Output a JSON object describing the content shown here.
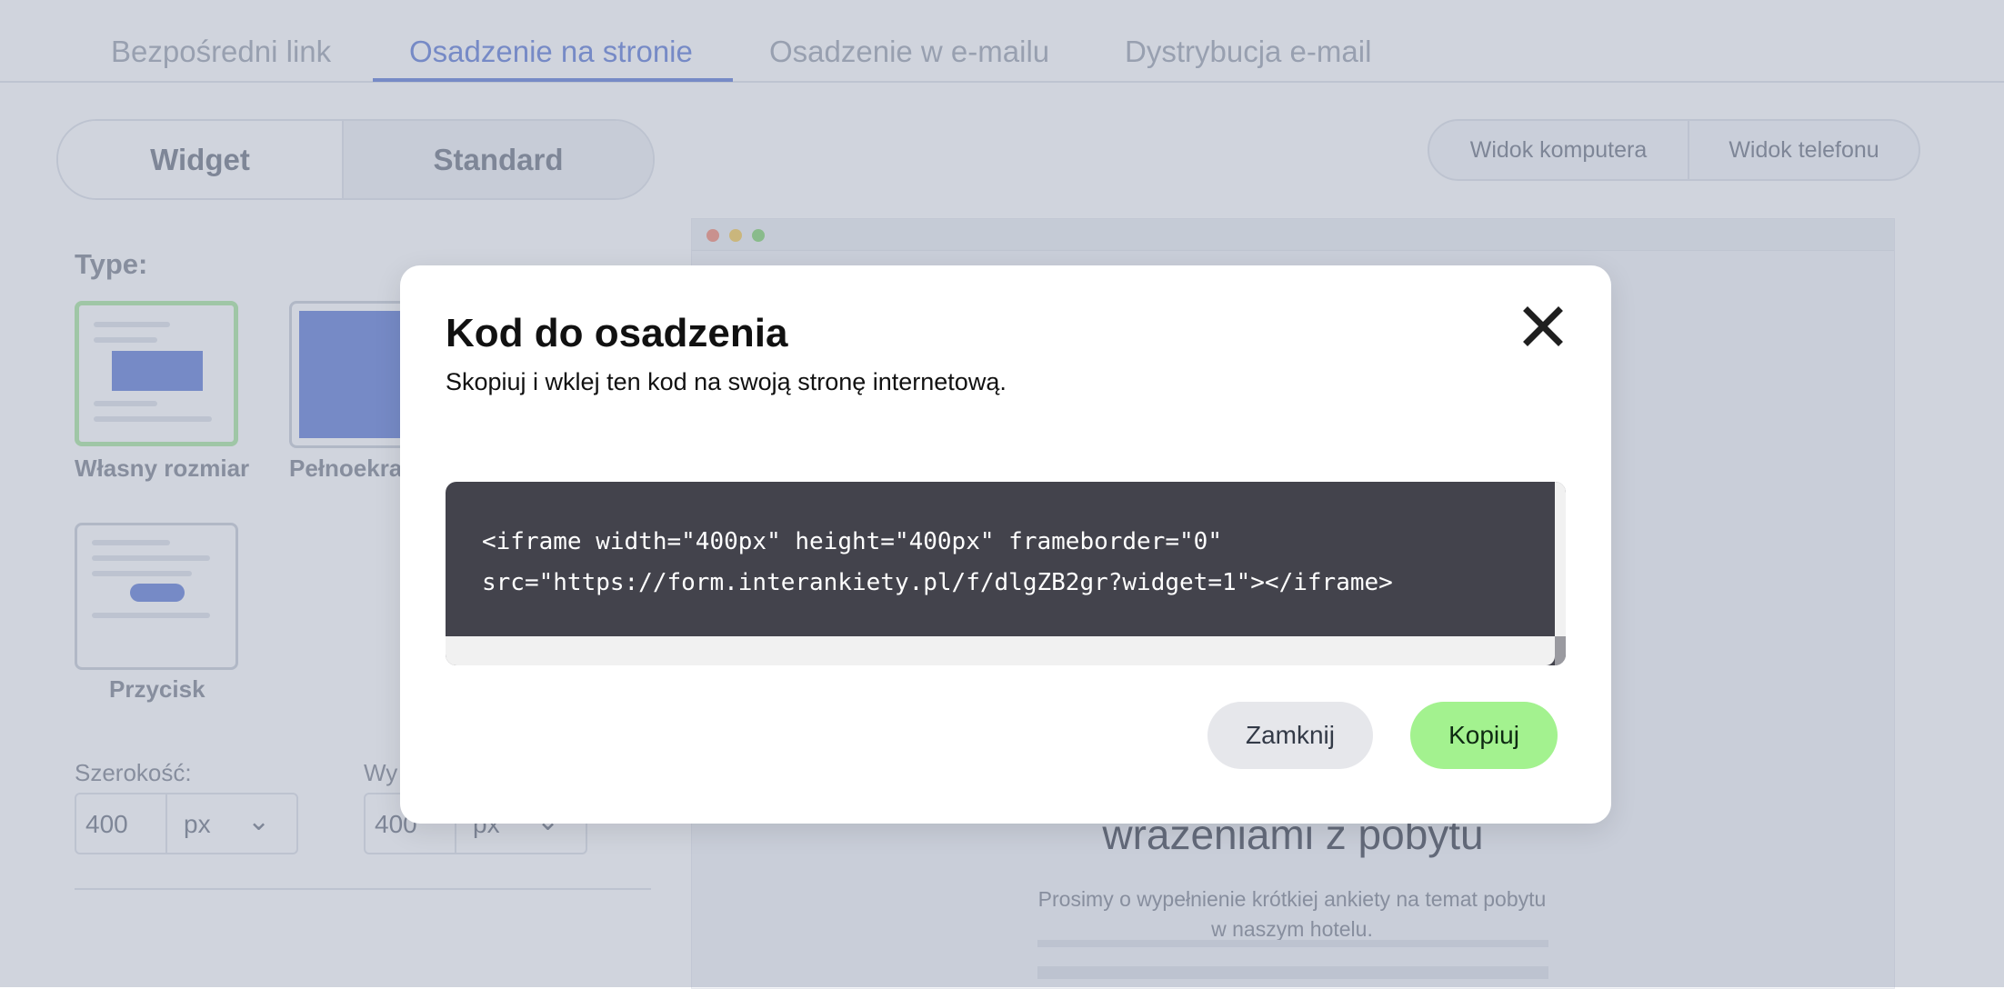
{
  "tabs": [
    {
      "label": "Bezpośredni link",
      "active": false
    },
    {
      "label": "Osadzenie na stronie",
      "active": true
    },
    {
      "label": "Osadzenie w e-mailu",
      "active": false
    },
    {
      "label": "Dystrybucja e-mail",
      "active": false
    }
  ],
  "embed_mode": {
    "widget": "Widget",
    "standard": "Standard"
  },
  "view_toggle": {
    "desktop": "Widok komputera",
    "phone": "Widok telefonu"
  },
  "type_section": {
    "label": "Type:",
    "options": [
      {
        "label": "Własny rozmiar",
        "selected": true
      },
      {
        "label": "Pełnoekra",
        "selected": false
      },
      {
        "label": "Przycisk",
        "selected": false
      }
    ]
  },
  "size": {
    "width_label": "Szerokość:",
    "width_value": "400",
    "width_unit": "px",
    "height_label": "Wy",
    "height_value": "400",
    "height_unit": "px"
  },
  "preview": {
    "title": "wrażeniami z pobytu",
    "text": "Prosimy o wypełnienie krótkiej ankiety na temat pobytu w naszym hotelu."
  },
  "modal": {
    "title": "Kod do osadzenia",
    "subtitle": "Skopiuj i wklej ten kod na swoją stronę internetową.",
    "code_line1": "<iframe width=\"400px\" height=\"400px\" frameborder=\"0\"",
    "code_line2": "src=\"https://form.interankiety.pl/f/dlgZB2gr?widget=1\"></iframe>",
    "close_label": "Zamknij",
    "copy_label": "Kopiuj"
  },
  "colors": {
    "accent": "#5b78d6",
    "copy_button": "#a3f28f",
    "code_background": "#43434c",
    "selected_card_border": "#a6e59b"
  },
  "icons": {
    "close": "close-x-icon",
    "dropdown": "chevron-down-icon"
  }
}
